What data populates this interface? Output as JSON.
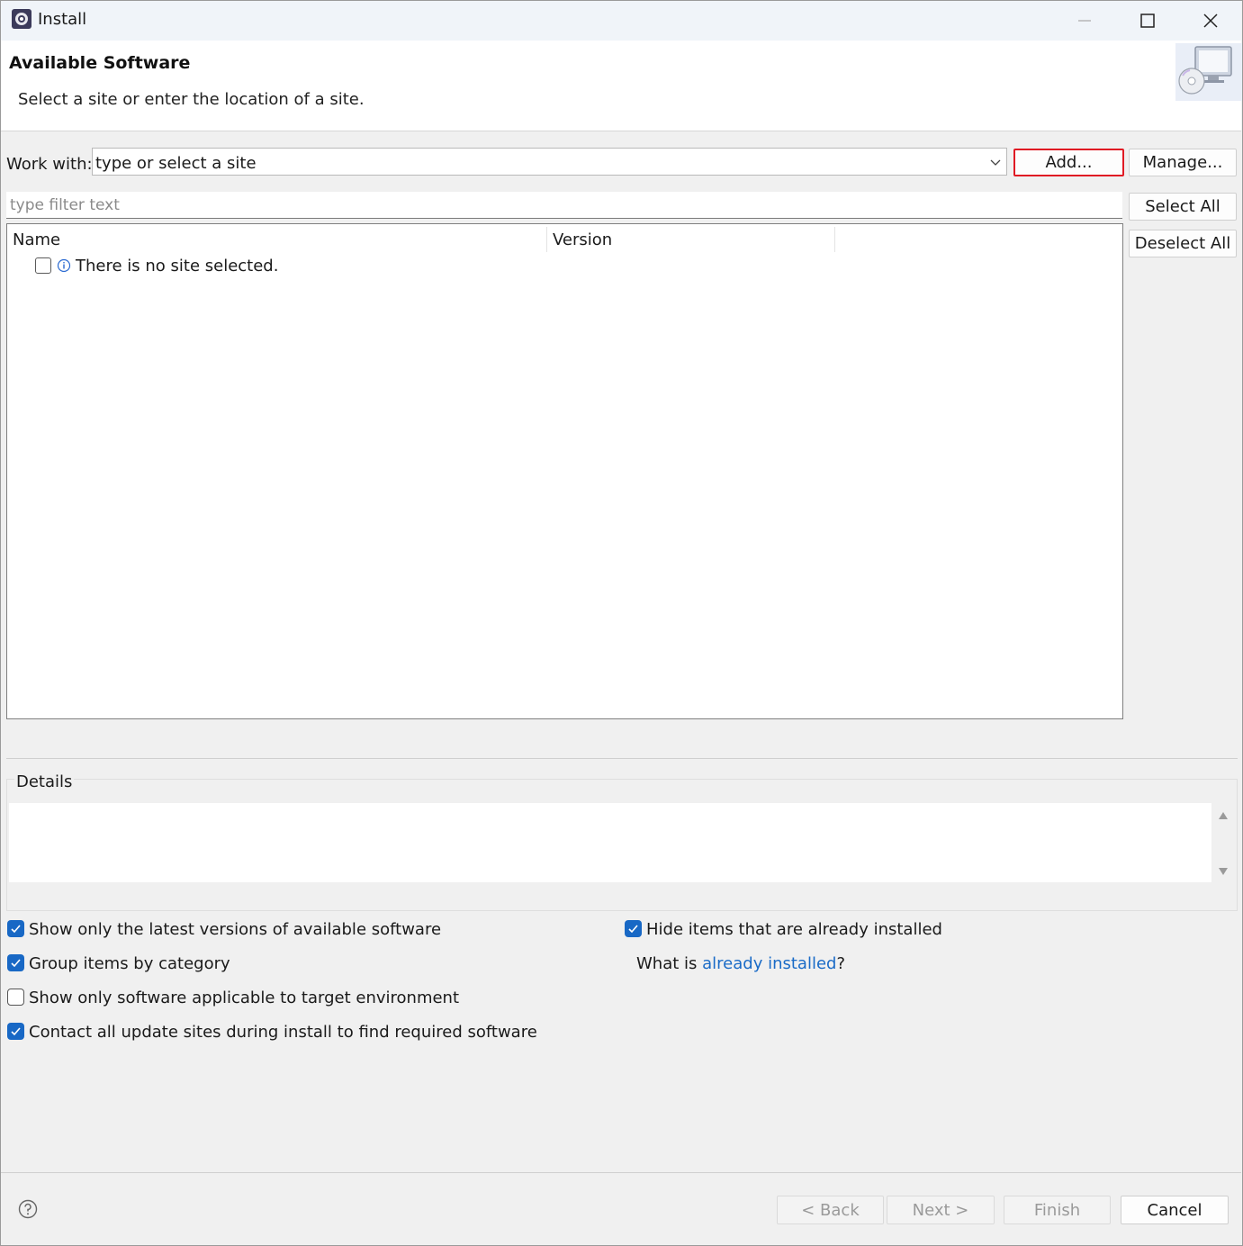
{
  "window": {
    "title": "Install"
  },
  "header": {
    "title": "Available Software",
    "description": "Select a site or enter the location of a site."
  },
  "work_with": {
    "label": "Work with:",
    "value": "type or select a site",
    "add_label": "Add...",
    "manage_label": "Manage..."
  },
  "filter": {
    "placeholder": "type filter text"
  },
  "selection_buttons": {
    "select_all": "Select All",
    "deselect_all": "Deselect All"
  },
  "table": {
    "columns": [
      "Name",
      "Version"
    ],
    "rows": [
      {
        "name": "There is no site selected.",
        "checked": false
      }
    ]
  },
  "details": {
    "label": "Details",
    "text": ""
  },
  "options": {
    "latest_versions": {
      "label": "Show only the latest versions of available software",
      "checked": true
    },
    "group_by_category": {
      "label": "Group items by category",
      "checked": true
    },
    "target_environment": {
      "label": "Show only software applicable to target environment",
      "checked": false
    },
    "contact_all_sites": {
      "label": "Contact all update sites during install to find required software",
      "checked": true
    },
    "hide_installed": {
      "label": "Hide items that are already installed",
      "checked": true
    },
    "what_is_prefix": "What is ",
    "already_installed_link": "already installed",
    "what_is_suffix": "?"
  },
  "footer": {
    "back": "< Back",
    "next": "Next >",
    "finish": "Finish",
    "cancel": "Cancel"
  },
  "colors": {
    "accent": "#1868c5",
    "highlight_border": "#e01a24",
    "link": "#1a6bc7"
  }
}
